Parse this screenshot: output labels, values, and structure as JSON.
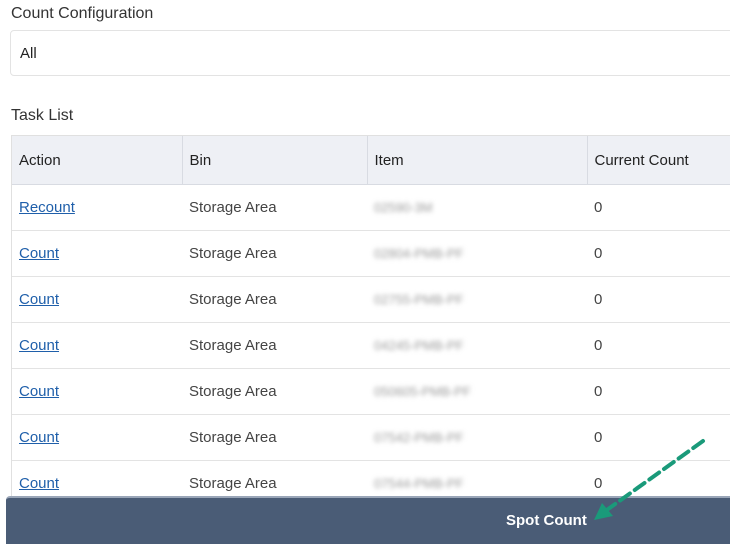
{
  "config": {
    "label": "Count Configuration",
    "value": "All"
  },
  "task_list": {
    "label": "Task List",
    "columns": [
      "Action",
      "Bin",
      "Item",
      "Current Count"
    ],
    "rows": [
      {
        "action": "Recount",
        "bin": "Storage Area",
        "item": "02590-3M",
        "count": "0"
      },
      {
        "action": "Count",
        "bin": "Storage Area",
        "item": "02804-PMB-PF",
        "count": "0"
      },
      {
        "action": "Count",
        "bin": "Storage Area",
        "item": "02755-PMB-PF",
        "count": "0"
      },
      {
        "action": "Count",
        "bin": "Storage Area",
        "item": "04245-PMB-PF",
        "count": "0"
      },
      {
        "action": "Count",
        "bin": "Storage Area",
        "item": "050605-PMB-PF",
        "count": "0"
      },
      {
        "action": "Count",
        "bin": "Storage Area",
        "item": "07542-PMB-PF",
        "count": "0"
      },
      {
        "action": "Count",
        "bin": "Storage Area",
        "item": "07544-PMB-PF",
        "count": "0"
      }
    ]
  },
  "footer": {
    "button_label": "Spot Count"
  },
  "colors": {
    "footer_bg": "#4a5c76",
    "header_bg": "#eef0f5",
    "link": "#1f5faa",
    "annotation_arrow": "#1a9a7a"
  }
}
